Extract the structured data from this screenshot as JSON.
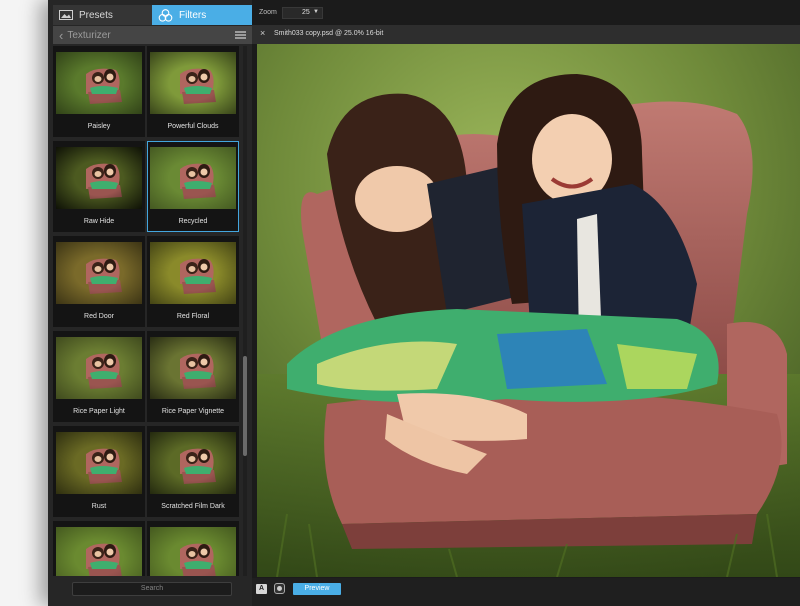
{
  "sidebar": {
    "tabs": [
      {
        "label": "Presets",
        "icon": "image-icon"
      },
      {
        "label": "Filters",
        "icon": "filters-icon",
        "active": true
      }
    ],
    "header": {
      "title": "Texturizer"
    },
    "filters": [
      {
        "label": "Paisley",
        "tint": "#5a7a2c",
        "vignette": 0.45
      },
      {
        "label": "Powerful Clouds",
        "tint": "#7f9a3a",
        "vignette": 0.55
      },
      {
        "label": "Raw Hide",
        "tint": "#4c5a20",
        "vignette": 0.8
      },
      {
        "label": "Recycled",
        "tint": "#6a8a34",
        "vignette": 0.35,
        "selected": true
      },
      {
        "label": "Red Door",
        "tint": "#7a6a2a",
        "vignette": 0.5
      },
      {
        "label": "Red Floral",
        "tint": "#8a8a2a",
        "vignette": 0.5
      },
      {
        "label": "Rice Paper Light",
        "tint": "#6b7d32",
        "vignette": 0.4
      },
      {
        "label": "Rice Paper Vignette",
        "tint": "#6a7432",
        "vignette": 0.6
      },
      {
        "label": "Rust",
        "tint": "#6a6a24",
        "vignette": 0.55
      },
      {
        "label": "Scratched Film Dark",
        "tint": "#5c6a26",
        "vignette": 0.6
      },
      {
        "label": "",
        "tint": "#6a8a30",
        "vignette": 0.35
      },
      {
        "label": "",
        "tint": "#6a8a30",
        "vignette": 0.35
      }
    ],
    "search": {
      "placeholder": "Search"
    }
  },
  "toolbar": {
    "zoom_label": "Zoom",
    "zoom_value": "25"
  },
  "document": {
    "title": "Smith033 copy.psd @ 25.0% 16-bit"
  },
  "bottom": {
    "compare_glyph": "A",
    "preview_label": "Preview"
  },
  "colors": {
    "accent": "#4aaee6",
    "panel": "#262626",
    "background": "#1b1b1b"
  }
}
